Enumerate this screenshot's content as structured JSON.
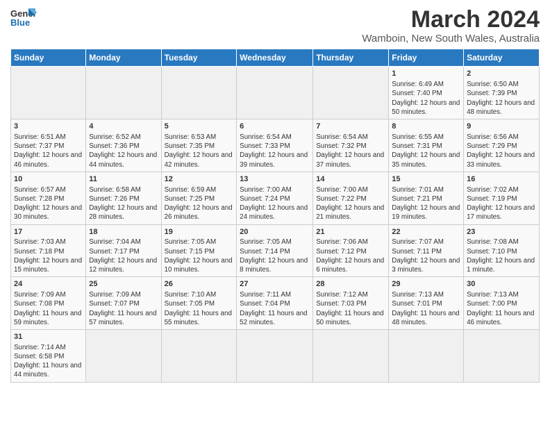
{
  "logo": {
    "text_general": "General",
    "text_blue": "Blue"
  },
  "header": {
    "month_title": "March 2024",
    "location": "Wamboin, New South Wales, Australia"
  },
  "days_of_week": [
    "Sunday",
    "Monday",
    "Tuesday",
    "Wednesday",
    "Thursday",
    "Friday",
    "Saturday"
  ],
  "weeks": [
    [
      {
        "day": "",
        "info": ""
      },
      {
        "day": "",
        "info": ""
      },
      {
        "day": "",
        "info": ""
      },
      {
        "day": "",
        "info": ""
      },
      {
        "day": "",
        "info": ""
      },
      {
        "day": "1",
        "info": "Sunrise: 6:49 AM\nSunset: 7:40 PM\nDaylight: 12 hours and 50 minutes."
      },
      {
        "day": "2",
        "info": "Sunrise: 6:50 AM\nSunset: 7:39 PM\nDaylight: 12 hours and 48 minutes."
      }
    ],
    [
      {
        "day": "3",
        "info": "Sunrise: 6:51 AM\nSunset: 7:37 PM\nDaylight: 12 hours and 46 minutes."
      },
      {
        "day": "4",
        "info": "Sunrise: 6:52 AM\nSunset: 7:36 PM\nDaylight: 12 hours and 44 minutes."
      },
      {
        "day": "5",
        "info": "Sunrise: 6:53 AM\nSunset: 7:35 PM\nDaylight: 12 hours and 42 minutes."
      },
      {
        "day": "6",
        "info": "Sunrise: 6:54 AM\nSunset: 7:33 PM\nDaylight: 12 hours and 39 minutes."
      },
      {
        "day": "7",
        "info": "Sunrise: 6:54 AM\nSunset: 7:32 PM\nDaylight: 12 hours and 37 minutes."
      },
      {
        "day": "8",
        "info": "Sunrise: 6:55 AM\nSunset: 7:31 PM\nDaylight: 12 hours and 35 minutes."
      },
      {
        "day": "9",
        "info": "Sunrise: 6:56 AM\nSunset: 7:29 PM\nDaylight: 12 hours and 33 minutes."
      }
    ],
    [
      {
        "day": "10",
        "info": "Sunrise: 6:57 AM\nSunset: 7:28 PM\nDaylight: 12 hours and 30 minutes."
      },
      {
        "day": "11",
        "info": "Sunrise: 6:58 AM\nSunset: 7:26 PM\nDaylight: 12 hours and 28 minutes."
      },
      {
        "day": "12",
        "info": "Sunrise: 6:59 AM\nSunset: 7:25 PM\nDaylight: 12 hours and 26 minutes."
      },
      {
        "day": "13",
        "info": "Sunrise: 7:00 AM\nSunset: 7:24 PM\nDaylight: 12 hours and 24 minutes."
      },
      {
        "day": "14",
        "info": "Sunrise: 7:00 AM\nSunset: 7:22 PM\nDaylight: 12 hours and 21 minutes."
      },
      {
        "day": "15",
        "info": "Sunrise: 7:01 AM\nSunset: 7:21 PM\nDaylight: 12 hours and 19 minutes."
      },
      {
        "day": "16",
        "info": "Sunrise: 7:02 AM\nSunset: 7:19 PM\nDaylight: 12 hours and 17 minutes."
      }
    ],
    [
      {
        "day": "17",
        "info": "Sunrise: 7:03 AM\nSunset: 7:18 PM\nDaylight: 12 hours and 15 minutes."
      },
      {
        "day": "18",
        "info": "Sunrise: 7:04 AM\nSunset: 7:17 PM\nDaylight: 12 hours and 12 minutes."
      },
      {
        "day": "19",
        "info": "Sunrise: 7:05 AM\nSunset: 7:15 PM\nDaylight: 12 hours and 10 minutes."
      },
      {
        "day": "20",
        "info": "Sunrise: 7:05 AM\nSunset: 7:14 PM\nDaylight: 12 hours and 8 minutes."
      },
      {
        "day": "21",
        "info": "Sunrise: 7:06 AM\nSunset: 7:12 PM\nDaylight: 12 hours and 6 minutes."
      },
      {
        "day": "22",
        "info": "Sunrise: 7:07 AM\nSunset: 7:11 PM\nDaylight: 12 hours and 3 minutes."
      },
      {
        "day": "23",
        "info": "Sunrise: 7:08 AM\nSunset: 7:10 PM\nDaylight: 12 hours and 1 minute."
      }
    ],
    [
      {
        "day": "24",
        "info": "Sunrise: 7:09 AM\nSunset: 7:08 PM\nDaylight: 11 hours and 59 minutes."
      },
      {
        "day": "25",
        "info": "Sunrise: 7:09 AM\nSunset: 7:07 PM\nDaylight: 11 hours and 57 minutes."
      },
      {
        "day": "26",
        "info": "Sunrise: 7:10 AM\nSunset: 7:05 PM\nDaylight: 11 hours and 55 minutes."
      },
      {
        "day": "27",
        "info": "Sunrise: 7:11 AM\nSunset: 7:04 PM\nDaylight: 11 hours and 52 minutes."
      },
      {
        "day": "28",
        "info": "Sunrise: 7:12 AM\nSunset: 7:03 PM\nDaylight: 11 hours and 50 minutes."
      },
      {
        "day": "29",
        "info": "Sunrise: 7:13 AM\nSunset: 7:01 PM\nDaylight: 11 hours and 48 minutes."
      },
      {
        "day": "30",
        "info": "Sunrise: 7:13 AM\nSunset: 7:00 PM\nDaylight: 11 hours and 46 minutes."
      }
    ],
    [
      {
        "day": "31",
        "info": "Sunrise: 7:14 AM\nSunset: 6:58 PM\nDaylight: 11 hours and 44 minutes."
      },
      {
        "day": "",
        "info": ""
      },
      {
        "day": "",
        "info": ""
      },
      {
        "day": "",
        "info": ""
      },
      {
        "day": "",
        "info": ""
      },
      {
        "day": "",
        "info": ""
      },
      {
        "day": "",
        "info": ""
      }
    ]
  ]
}
